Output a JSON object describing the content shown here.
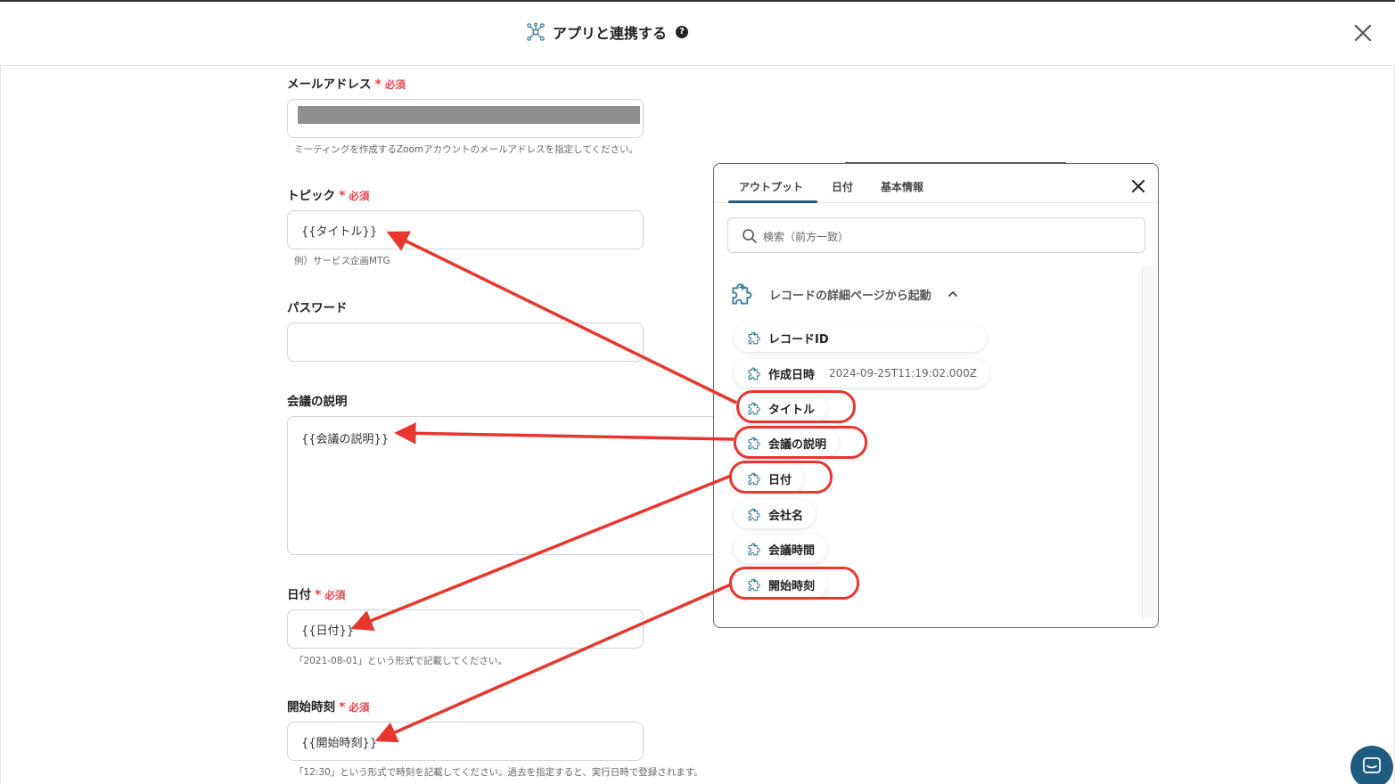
{
  "header": {
    "title": "アプリと連携する",
    "help": "?"
  },
  "fields": {
    "email": {
      "label": "メールアドレス",
      "required": "必須",
      "value": "",
      "hint": "ミーティングを作成するZoomアカウントのメールアドレスを指定してください。"
    },
    "topic": {
      "label": "トピック",
      "required": "必須",
      "value": "{{タイトル}}",
      "hint": "例）サービス企画MTG"
    },
    "password": {
      "label": "パスワード",
      "value": ""
    },
    "description": {
      "label": "会議の説明",
      "value": "{{会議の説明}}"
    },
    "date": {
      "label": "日付",
      "required": "必須",
      "value": "{{日付}}",
      "hint": "「2021-08-01」という形式で記載してください。"
    },
    "start_time": {
      "label": "開始時刻",
      "required": "必須",
      "value": "{{開始時刻}}",
      "hint": "「12:30」という形式で時刻を記載してください。過去を指定すると、実行日時で登録されます。"
    }
  },
  "popup": {
    "tabs": [
      "アウトプット",
      "日付",
      "基本情報"
    ],
    "active_tab": "アウトプット",
    "search_placeholder": "検索（前方一致）",
    "group": "レコードの詳細ページから起動",
    "items": [
      {
        "label": "レコードID",
        "value": ""
      },
      {
        "label": "作成日時",
        "value": "2024-09-25T11:19:02.000Z"
      },
      {
        "label": "タイトル",
        "value": ""
      },
      {
        "label": "会議の説明",
        "value": ""
      },
      {
        "label": "日付",
        "value": ""
      },
      {
        "label": "会社名",
        "value": ""
      },
      {
        "label": "会議時間",
        "value": ""
      },
      {
        "label": "開始時刻",
        "value": ""
      }
    ],
    "highlighted_items": [
      "タイトル",
      "会議の説明",
      "日付",
      "開始時刻"
    ]
  },
  "colors": {
    "required": "#e8464f",
    "annotation": "#e8362e",
    "tab_accent": "#27597a",
    "chat_button": "#1e5c80",
    "icon": "#3f7f9a"
  },
  "icons": {
    "header": "hub-icon",
    "close": "close-icon",
    "search": "search-icon",
    "item": "puzzle-icon",
    "group_toggle": "chevron-up-icon",
    "chat": "chat-icon"
  }
}
